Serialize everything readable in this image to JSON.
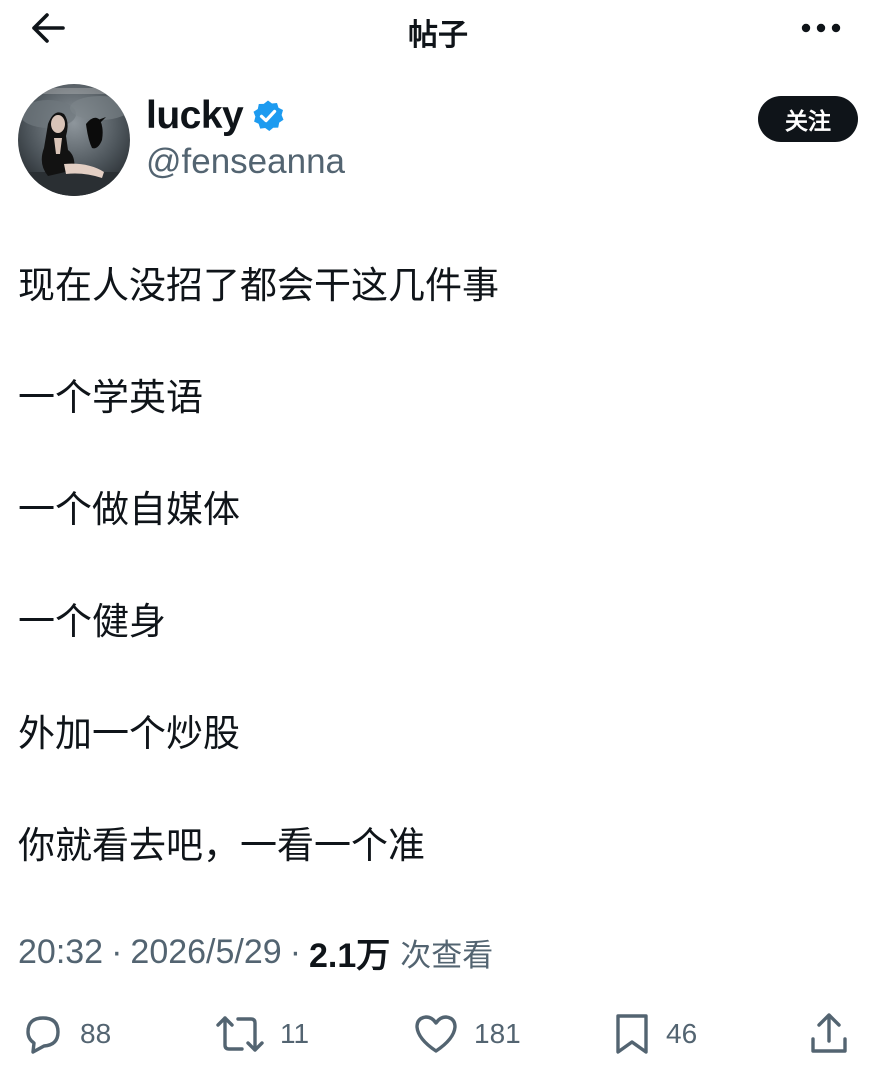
{
  "header": {
    "title": "帖子",
    "back_icon": "arrow-left-icon",
    "more_icon": "more-horizontal-icon"
  },
  "author": {
    "display_name": "lucky",
    "handle": "@fenseanna",
    "verified": true,
    "follow_label": "关注"
  },
  "post": {
    "lines": [
      "现在人没招了都会干这几件事",
      "一个学英语",
      "一个做自媒体",
      "一个健身",
      "外加一个炒股",
      "你就看去吧，一看一个准"
    ],
    "time": "20:32",
    "date": "2026/5/29",
    "separator": "·",
    "views": "2.1万",
    "views_label": "次查看"
  },
  "actions": {
    "replies": "88",
    "reposts": "11",
    "likes": "181",
    "bookmarks": "46"
  },
  "colors": {
    "text": "#0f1419",
    "secondary": "#536471",
    "verified": "#1d9bf0",
    "button_bg": "#0f1419"
  }
}
